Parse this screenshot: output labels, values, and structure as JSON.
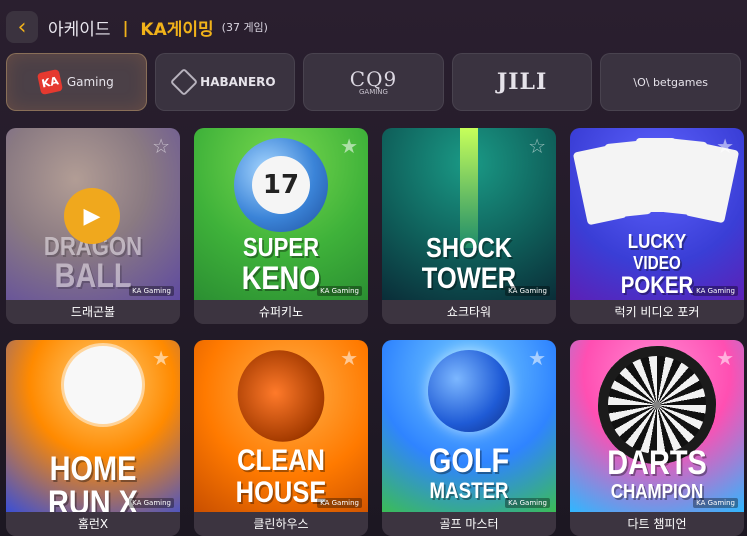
{
  "header": {
    "back_icon": "chevron-left-icon",
    "section": "아케이드",
    "separator": "|",
    "provider": "KA게이밍",
    "count": "(37 게임)"
  },
  "providers": [
    {
      "name": "KA Gaming",
      "label": "Gaming",
      "active": true
    },
    {
      "name": "Habanero",
      "label": "HABANERO",
      "active": false
    },
    {
      "name": "CQ9 Gaming",
      "label": "CQ9",
      "sub": "GAMING",
      "active": false
    },
    {
      "name": "JILI",
      "label": "JILI",
      "active": false
    },
    {
      "name": "betgames",
      "label": "\\O\\ betgames",
      "active": false
    }
  ],
  "games": [
    {
      "name": "드래곤볼",
      "title_lines": [
        "DRAGON",
        "BALL"
      ],
      "badge": "KA Gaming",
      "colors": [
        "#9a8a8a",
        "#6a5fb0"
      ]
    },
    {
      "name": "슈퍼키노",
      "title_lines": [
        "SUPER",
        "KENO"
      ],
      "ball_number": "17",
      "badge": "KA Gaming",
      "colors": [
        "#58c13a",
        "#2a9e36"
      ]
    },
    {
      "name": "쇼크타워",
      "title_lines": [
        "SHOCK",
        "TOWER"
      ],
      "badge": "KA Gaming",
      "colors": [
        "#0f6f6a",
        "#0a3a44"
      ]
    },
    {
      "name": "럭키 비디오 포커",
      "title_lines": [
        "LUCKY",
        "VIDEO",
        "POKER"
      ],
      "badge": "KA Gaming",
      "colors": [
        "#3f45d9",
        "#6b27c7"
      ]
    },
    {
      "name": "홈런X",
      "title_lines": [
        "HOME RUN X"
      ],
      "badge": "KA Gaming",
      "colors": [
        "#ff7a00",
        "#3b4fd6"
      ]
    },
    {
      "name": "클린하우스",
      "title_lines": [
        "CLEAN",
        "HOUSE"
      ],
      "badge": "KA Gaming",
      "colors": [
        "#ff8a00",
        "#e35d00"
      ]
    },
    {
      "name": "골프 마스터",
      "title_lines": [
        "GOLF",
        "MASTER"
      ],
      "badge": "KA Gaming",
      "colors": [
        "#46b3ff",
        "#2f77ff"
      ]
    },
    {
      "name": "다트 챔피언",
      "title_lines": [
        "DARTS",
        "CHAMPION"
      ],
      "badge": "KA Gaming",
      "colors": [
        "#ff4fb2",
        "#30b7ff"
      ]
    }
  ]
}
